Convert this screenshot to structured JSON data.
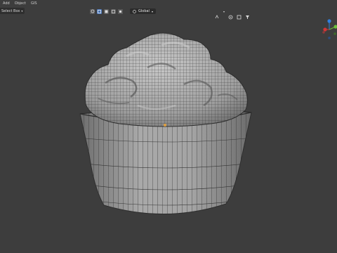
{
  "header": {
    "menus": [
      "Add",
      "Object",
      "GIS"
    ],
    "select_mode": "Select Box"
  },
  "toolbar": {
    "pivot_label": "Global"
  },
  "gizmo": {
    "axes": [
      {
        "name": "Y",
        "color": "#6bbd3a"
      },
      {
        "name": "Z",
        "color": "#2f7fe0"
      },
      {
        "name": "X",
        "color": "#d23636"
      }
    ]
  },
  "colors": {
    "viewport_bg": "#3d3d3d",
    "mesh_fill": "#a8a8a8",
    "mesh_line": "#2b2b2b",
    "accent": "#4772b3"
  },
  "viewport": {
    "object": "cupcake-mesh"
  }
}
